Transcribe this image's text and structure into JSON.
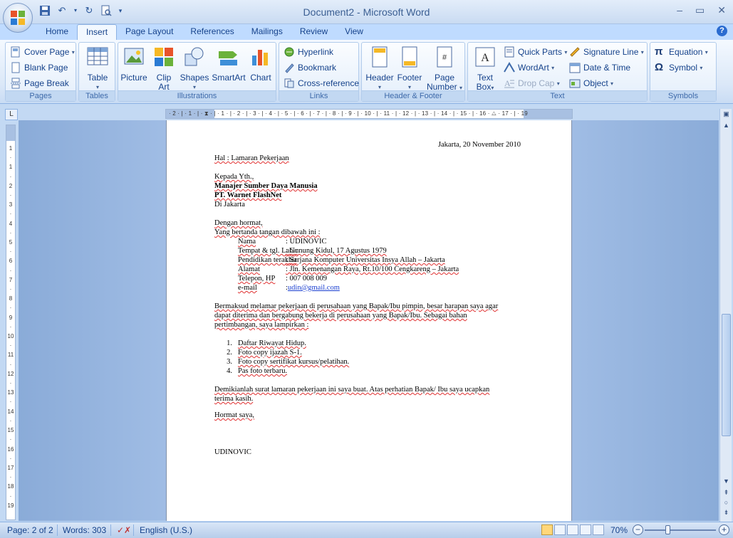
{
  "window": {
    "title": "Document2 - Microsoft Word",
    "controls": [
      "–",
      "▭",
      "✕"
    ]
  },
  "tabs": [
    "Home",
    "Insert",
    "Page Layout",
    "References",
    "Mailings",
    "Review",
    "View"
  ],
  "active_tab": "Insert",
  "ribbon": {
    "pages": {
      "label": "Pages",
      "cover_page": "Cover Page",
      "blank_page": "Blank Page",
      "page_break": "Page Break"
    },
    "tables": {
      "label": "Tables",
      "table": "Table"
    },
    "illustrations": {
      "label": "Illustrations",
      "picture": "Picture",
      "clip_art_1": "Clip",
      "clip_art_2": "Art",
      "shapes": "Shapes",
      "smartart": "SmartArt",
      "chart": "Chart"
    },
    "links": {
      "label": "Links",
      "hyperlink": "Hyperlink",
      "bookmark": "Bookmark",
      "cross_reference": "Cross-reference"
    },
    "header_footer": {
      "label": "Header & Footer",
      "header": "Header",
      "footer": "Footer",
      "page_number_1": "Page",
      "page_number_2": "Number"
    },
    "text": {
      "label": "Text",
      "text_box_1": "Text",
      "text_box_2": "Box",
      "quick_parts": "Quick Parts",
      "wordart": "WordArt",
      "drop_cap": "Drop Cap",
      "signature_line": "Signature Line",
      "date_time": "Date & Time",
      "object": "Object"
    },
    "symbols": {
      "label": "Symbols",
      "equation": "Equation",
      "symbol": "Symbol"
    }
  },
  "ruler": {
    "h_ticks": "· 2 · | · 1 · | · ⧗ · | · 1 · | · 2 · | · 3 · | · 4 · | · 5 · | · 6 · | · 7 · | · 8 · | · 9 · | · 10 · | · 11 · | · 12 · | · 13 · | · 14 · | · 15 · | · 16 · △ · 17 · | · 19",
    "v_ticks": [
      "1",
      "·",
      "1",
      "·",
      "2",
      "·",
      "3",
      "·",
      "4",
      "·",
      "5",
      "·",
      "6",
      "·",
      "7",
      "·",
      "8",
      "·",
      "9",
      "·",
      "10",
      "·",
      "11",
      "·",
      "12",
      "·",
      "13",
      "·",
      "14",
      "·",
      "15",
      "·",
      "16",
      "·",
      "17",
      "·",
      "18",
      "·",
      "19"
    ]
  },
  "document": {
    "date": "Jakarta, 20 November 2010",
    "subject": "Hal : Lamaran Pekerjaan",
    "to_1": "Kepada Yth.,",
    "to_2": "Manajer Sumber Daya Manusia",
    "to_3": "PT. Warnet FlashNet",
    "to_4": "Di Jakarta",
    "greeting": "Dengan hormat,",
    "intro": "Yang bertanda tangan dibawah ini :",
    "fields": [
      {
        "label": "Nama",
        "value": ": UDINOVIC"
      },
      {
        "label": "Tempat & tgl. Lahir",
        "value": ": Gunung Kidul, 17 Agustus 1979"
      },
      {
        "label": "Pendidikan terakhir",
        "value": ": Sarjana Komputer Universitas Insya Allah – Jakarta"
      },
      {
        "label": "Alamat",
        "value": ": Jln. Kemenangan Raya, Rt.10/100 Cengkareng – Jakarta"
      },
      {
        "label": "Telepon, HP",
        "value": ": 007 008 009"
      },
      {
        "label": "e-mail",
        "value_prefix": ": ",
        "value": "udin@gmail.com"
      }
    ],
    "para1_l1": "Bermaksud melamar pekerjaan di perusahaan yang Bapak/Ibu pimpin, besar harapan saya agar",
    "para1_l2": "dapat diterima dan bergabung bekerja di perusahaan yang Bapak/Ibu. Sebagai bahan",
    "para1_l3": "pertimbangan, saya lampirkan :",
    "list": [
      "Daftar Riwayat Hidup.",
      "Foto copy ijazah S-1.",
      "Foto copy sertifikat kursus/pelatihan.",
      "Pas foto terbaru."
    ],
    "list_nums": [
      "1.",
      "2.",
      "3.",
      "4."
    ],
    "closing_l1": "Demikianlah surat lamaran pekerjaan ini saya buat. Atas perhatian Bapak/ Ibu saya ucapkan",
    "closing_l2": "terima kasih.",
    "regards": "Hormat saya,",
    "signature": "UDINOVIC"
  },
  "status": {
    "page": "Page: 2 of 2",
    "words": "Words: 303",
    "language": "English (U.S.)",
    "zoom": "70%",
    "zoom_value": 70
  }
}
